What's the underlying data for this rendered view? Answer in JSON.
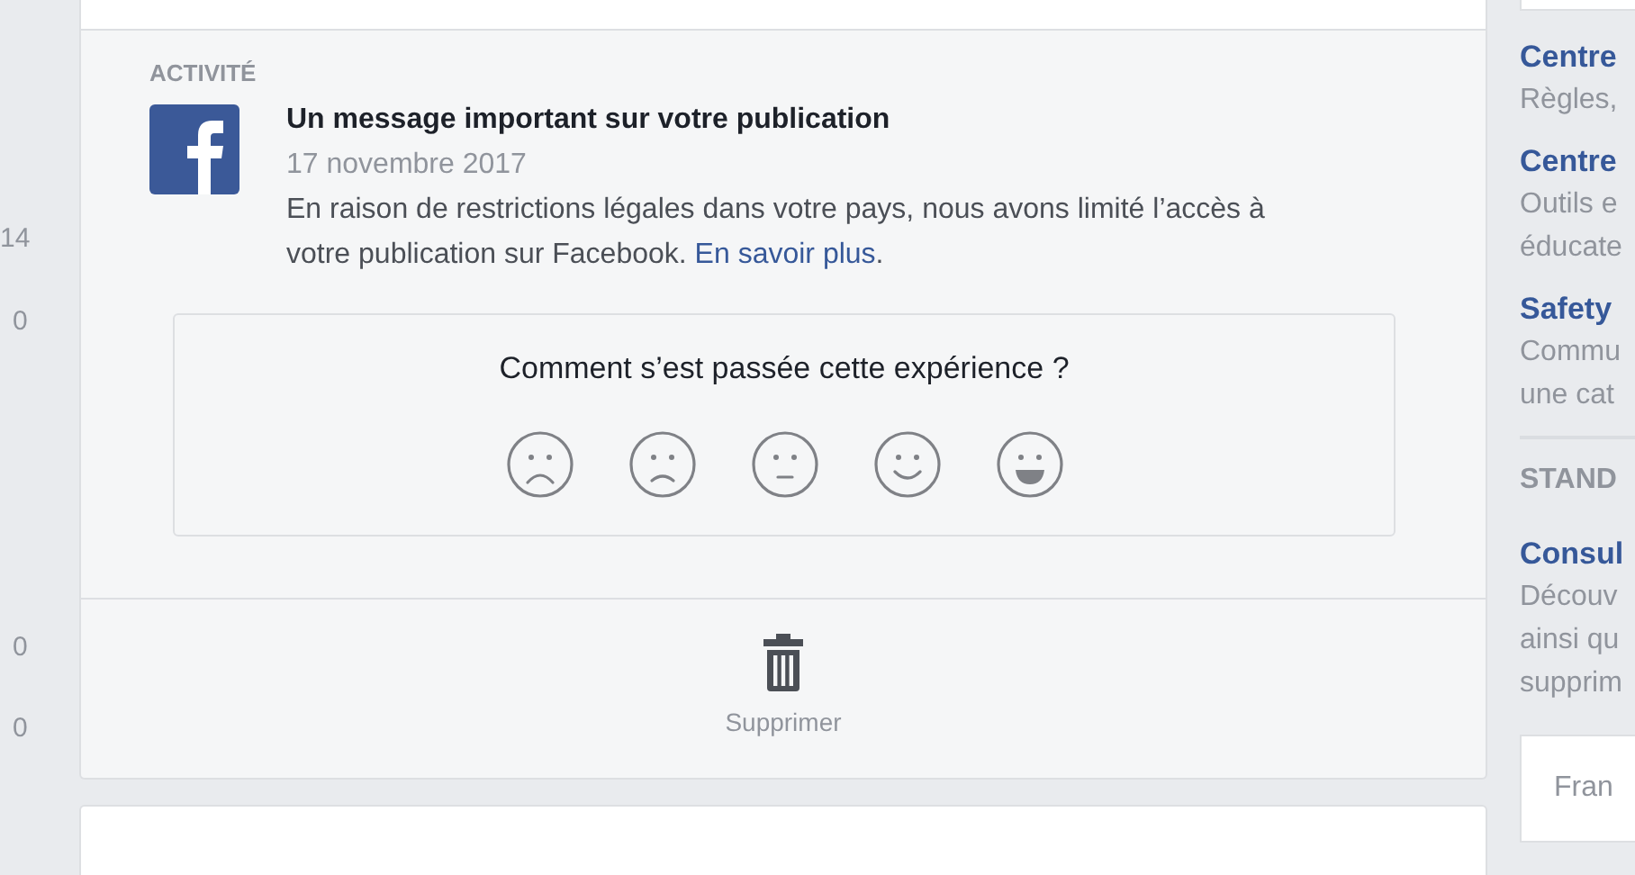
{
  "left_column": {
    "numbers": [
      "14",
      "0",
      "0",
      "0"
    ]
  },
  "activity": {
    "heading": "ACTIVITÉ",
    "title": "Un message important sur votre publication",
    "date": "17 novembre 2017",
    "body": "En raison de restrictions légales dans votre pays, nous avons limité l’accès à votre publication sur Facebook.",
    "link": "En savoir plus",
    "link_after": "."
  },
  "feedback": {
    "question": "Comment s’est passée cette expérience ?",
    "reactions": [
      {
        "kind": "very_sad"
      },
      {
        "kind": "sad"
      },
      {
        "kind": "neutral"
      },
      {
        "kind": "happy"
      },
      {
        "kind": "very_happy"
      }
    ]
  },
  "footer": {
    "delete_label": "Supprimer"
  },
  "sidebar": {
    "groups": [
      {
        "links": [
          {
            "title": "Centre",
            "lines": [
              "Règles,"
            ]
          },
          {
            "title": "Centre",
            "lines": [
              "Outils e",
              "éducate"
            ]
          },
          {
            "title": "Safety",
            "lines": [
              "Commu",
              "une cat"
            ]
          }
        ]
      },
      {
        "heading": "STAND",
        "links": [
          {
            "title": "Consul",
            "lines": [
              "Découv",
              "ainsi qu",
              "supprim"
            ]
          }
        ]
      }
    ],
    "language_box": "Fran"
  }
}
